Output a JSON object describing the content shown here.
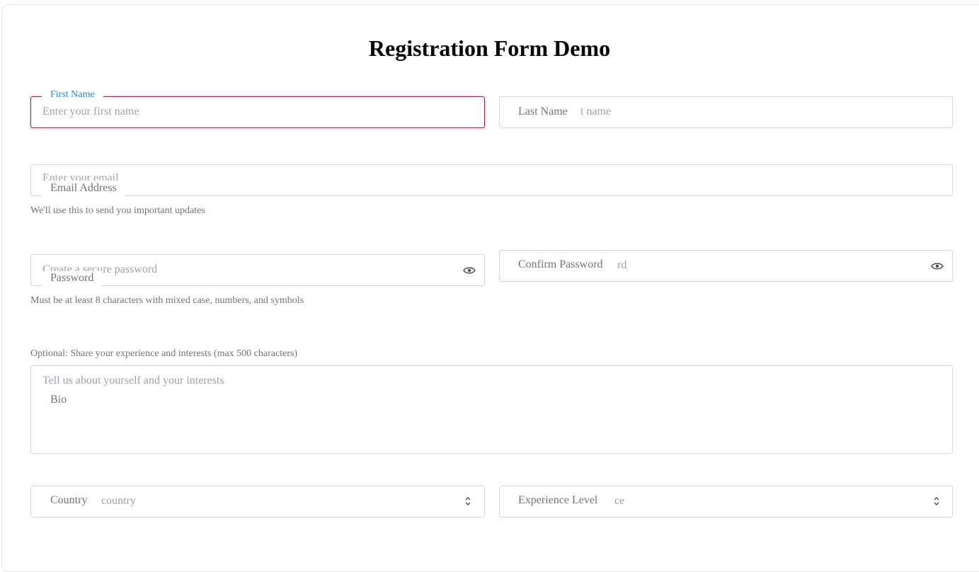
{
  "title": "Registration Form Demo",
  "first_name": {
    "label": "First Name",
    "placeholder": "Enter your first name"
  },
  "last_name": {
    "label": "Last Name",
    "placeholder_visible": "t name"
  },
  "email": {
    "label": "Email Address",
    "placeholder_visible": "Enter your email",
    "help": "We'll use this to send you important updates"
  },
  "password": {
    "label": "Password",
    "placeholder_visible": "Create a secure password",
    "help": "Must be at least 8 characters with mixed case, numbers, and symbols",
    "icon": "eye-icon"
  },
  "confirm_password": {
    "label": "Confirm Password",
    "placeholder_visible": "rd",
    "icon": "eye-icon"
  },
  "bio": {
    "help": "Optional: Share your experience and interests (max 500 characters)",
    "placeholder": "Tell us about yourself and your interests",
    "label": "Bio"
  },
  "country": {
    "label": "Country",
    "placeholder_visible": "country",
    "icon": "chevron-up-down-icon"
  },
  "experience": {
    "label": "Experience Level",
    "placeholder_visible": "ce",
    "icon": "chevron-up-down-icon"
  },
  "colors": {
    "focus_border": "#8c2a4a",
    "floating_label": "#2a86d8",
    "muted_text": "#6c757d",
    "placeholder": "#9aa2ac",
    "border": "#d2d6db"
  }
}
